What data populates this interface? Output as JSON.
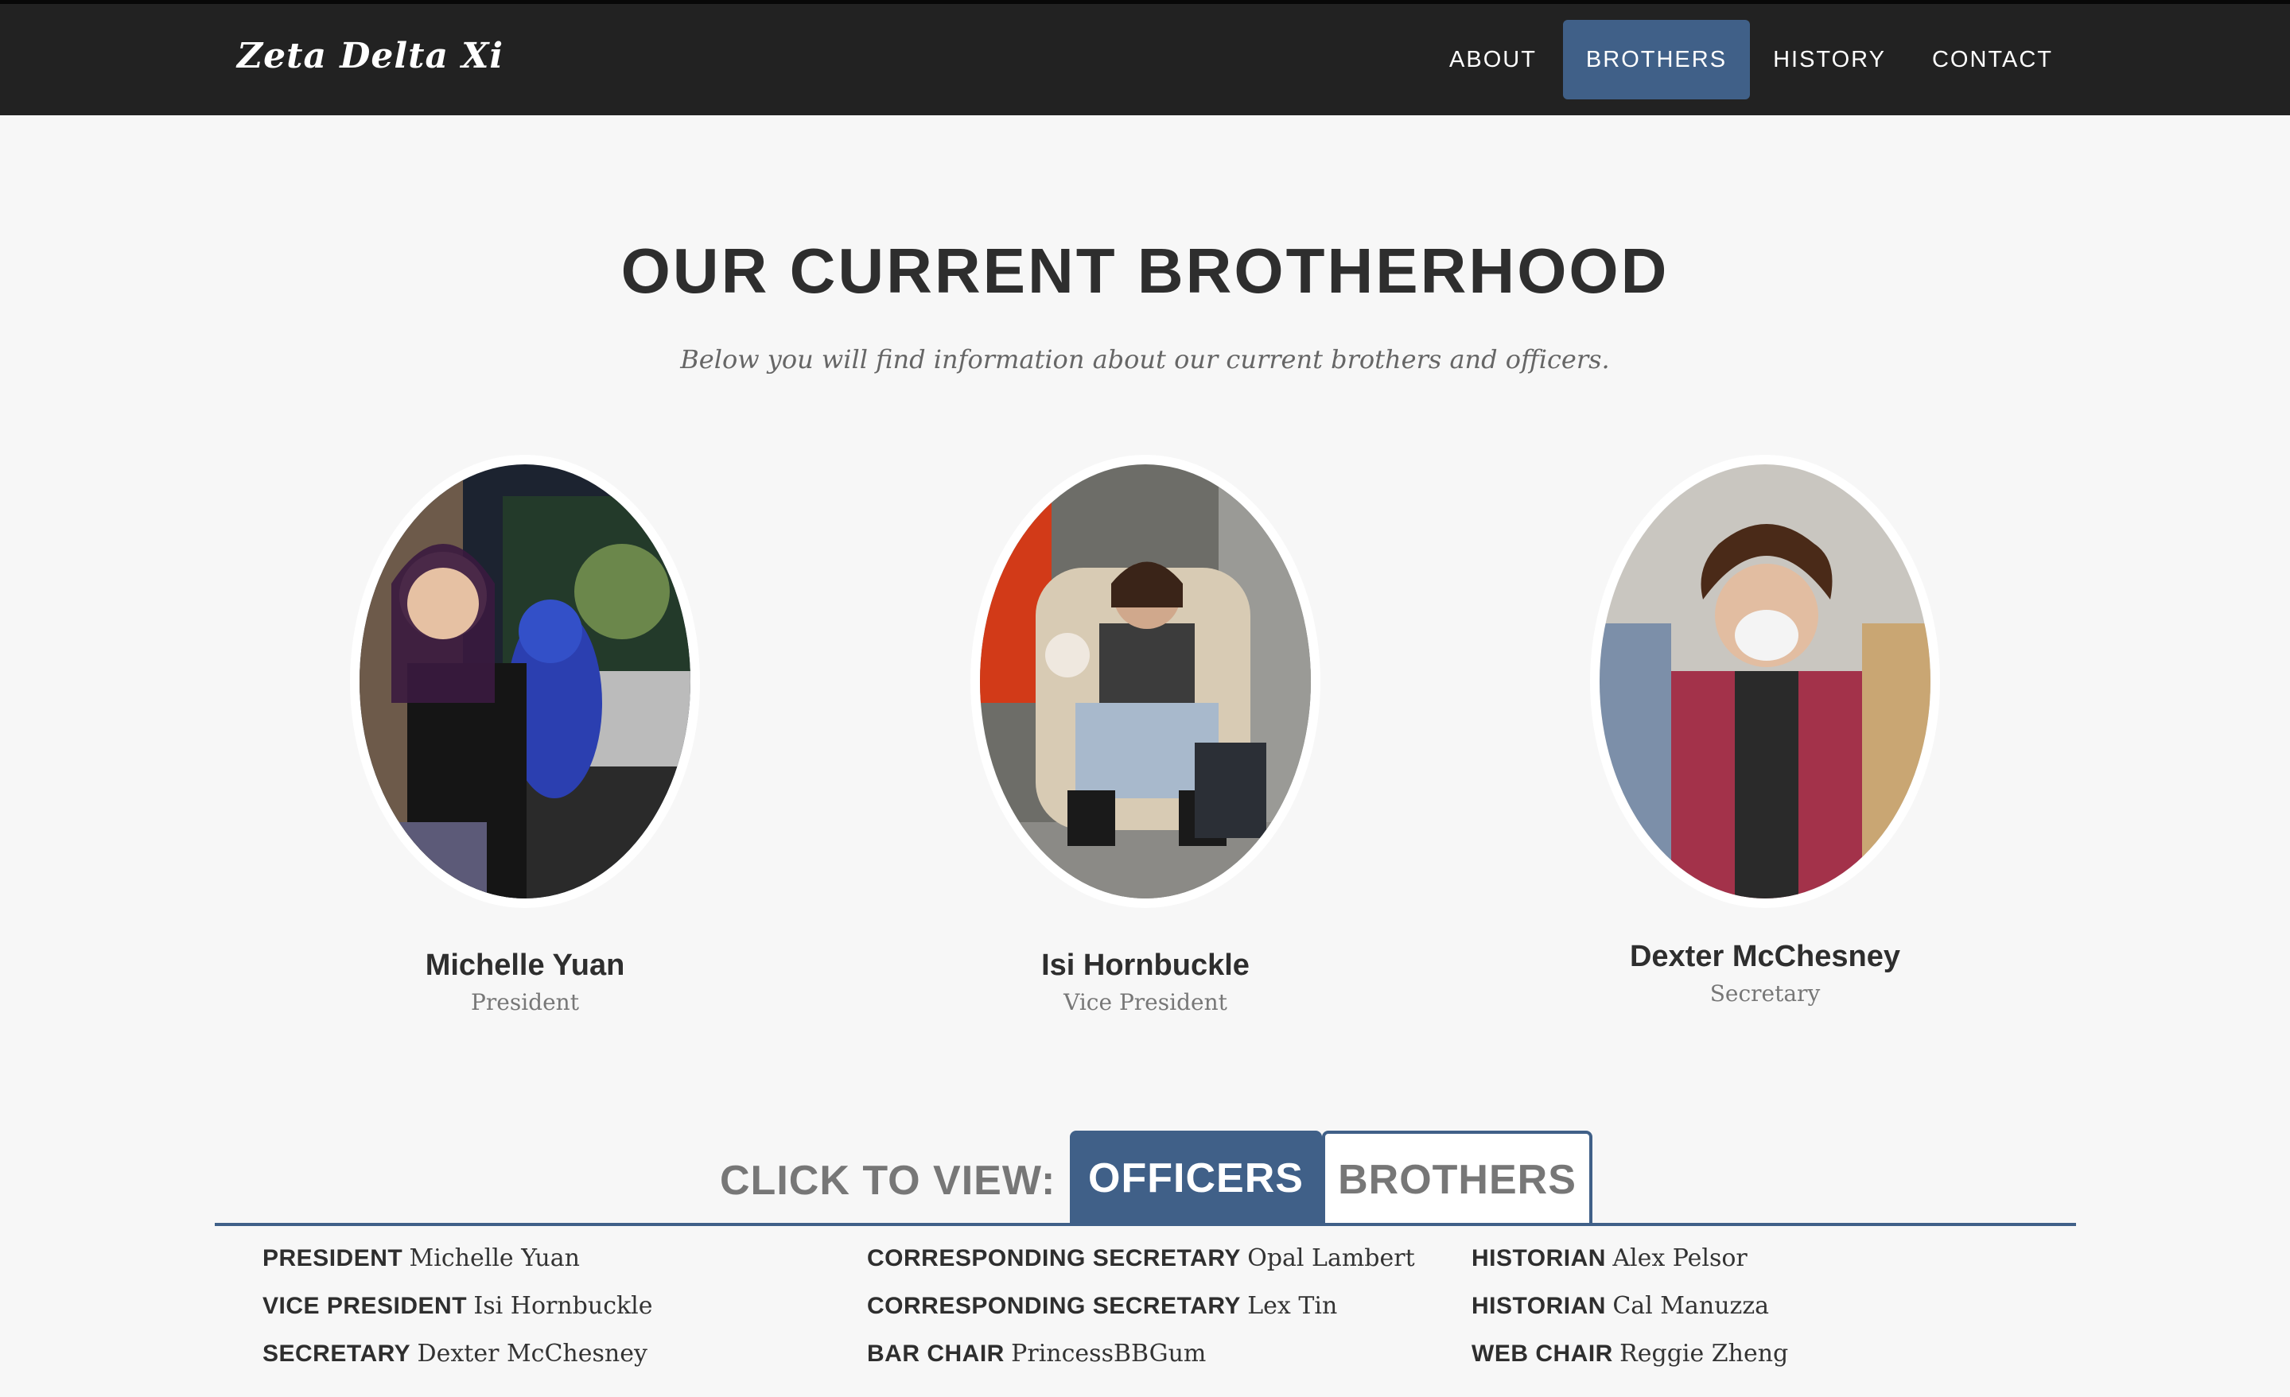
{
  "nav": {
    "brand": "Zeta Delta Xi",
    "links": [
      {
        "label": "ABOUT",
        "active": false
      },
      {
        "label": "BROTHERS",
        "active": true
      },
      {
        "label": "HISTORY",
        "active": false
      },
      {
        "label": "CONTACT",
        "active": false
      }
    ]
  },
  "header": {
    "title": "OUR CURRENT BROTHERHOOD",
    "subtitle": "Below you will find information about our current brothers and officers."
  },
  "officers": [
    {
      "name": "Michelle Yuan",
      "role": "President"
    },
    {
      "name": "Isi Hornbuckle",
      "role": "Vice President"
    },
    {
      "name": "Dexter McChesney",
      "role": "Secretary"
    }
  ],
  "tabs": {
    "label": "CLICK TO VIEW:",
    "officers": "OFFICERS",
    "brothers": "BROTHERS",
    "active": "OFFICERS"
  },
  "roster": {
    "columns": [
      [
        {
          "title": "PRESIDENT",
          "name": "Michelle Yuan"
        },
        {
          "title": "VICE PRESIDENT",
          "name": "Isi Hornbuckle"
        },
        {
          "title": "SECRETARY",
          "name": "Dexter McChesney"
        }
      ],
      [
        {
          "title": "CORRESPONDING SECRETARY",
          "name": "Opal Lambert"
        },
        {
          "title": "CORRESPONDING SECRETARY",
          "name": "Lex Tin"
        },
        {
          "title": "BAR CHAIR",
          "name": "PrincessBBGum"
        }
      ],
      [
        {
          "title": "HISTORIAN",
          "name": "Alex Pelsor"
        },
        {
          "title": "HISTORIAN",
          "name": "Cal Manuzza"
        },
        {
          "title": "WEB CHAIR",
          "name": "Reggie Zheng"
        }
      ]
    ]
  },
  "colors": {
    "navbar": "#222222",
    "accent": "#406088",
    "page_bg": "#f7f7f7"
  }
}
